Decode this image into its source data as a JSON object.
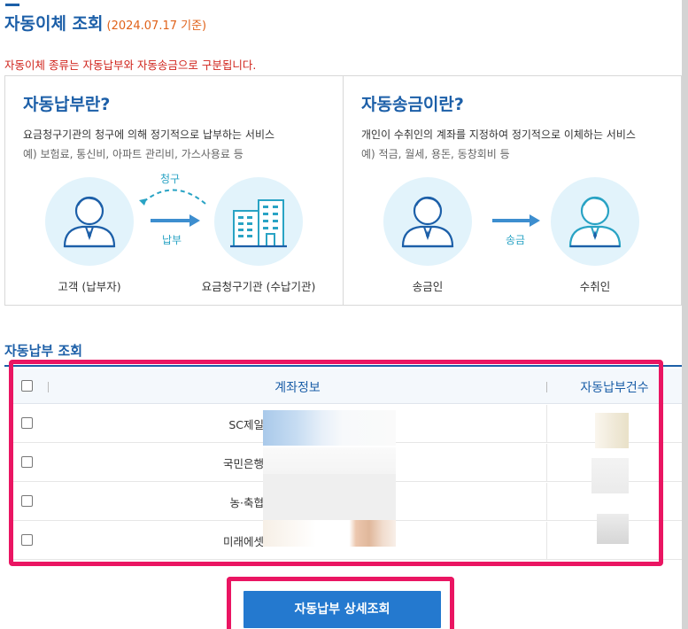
{
  "header": {
    "title": "자동이체 조회",
    "date_note": "(2024.07.17 기준)"
  },
  "notice": "자동이체 종류는 자동납부와 자동송금으로 구분됩니다.",
  "info": {
    "auto_pay": {
      "heading": "자동납부란?",
      "description": "요금청구기관의 청구에 의해 정기적으로 납부하는 서비스",
      "example": "예) 보험료, 통신비, 아파트 관리비, 가스사용료 등",
      "flow_top_label": "청구",
      "flow_bottom_label": "납부",
      "left_caption": "고객 (납부자)",
      "right_caption": "요금청구기관 (수납기관)"
    },
    "auto_transfer": {
      "heading": "자동송금이란?",
      "description": "개인이 수취인의 계좌를 지정하여 정기적으로 이체하는 서비스",
      "example": "예) 적금, 월세, 용돈, 동창회비 등",
      "flow_label": "송금",
      "left_caption": "송금인",
      "right_caption": "수취인"
    }
  },
  "section_title": "자동납부 조회",
  "table": {
    "headers": {
      "account": "계좌정보",
      "count": "자동납부건수"
    },
    "rows": [
      {
        "bank": "SC제일"
      },
      {
        "bank": "국민은행"
      },
      {
        "bank": "농·축협"
      },
      {
        "bank": "미래에셋"
      }
    ]
  },
  "button": {
    "label": "자동납부 상세조회"
  },
  "colors": {
    "accent": "#1c5fa8",
    "highlight": "#ea1562",
    "button": "#2479cf",
    "notice": "#d0241c",
    "flow": "#29a3c4"
  }
}
